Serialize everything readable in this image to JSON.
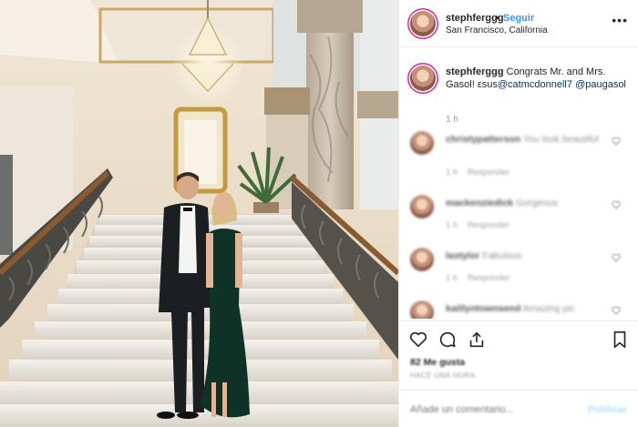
{
  "header": {
    "username": "stephferggg",
    "dot": "•",
    "follow_label": "Seguir",
    "location": "San Francisco, California",
    "more_label": "•••"
  },
  "caption": {
    "username": "stephferggg",
    "text": "Congrats Mr. and Mrs. Gasol!",
    "via": "εsus",
    "mention1": "@catmcdonnell7",
    "mention2": "@paugasol",
    "time": "1 h"
  },
  "comments": [
    {
      "username": "christypatterson",
      "text": "You look beautiful",
      "time": "1 h",
      "reply": "Responder"
    },
    {
      "username": "mackenziedick",
      "text": "Gorgeous",
      "time": "1 h",
      "reply": "Responder"
    },
    {
      "username": "lastylor",
      "text": "Fabulous",
      "time": "1 h",
      "reply": "Responder"
    },
    {
      "username": "kaitlyntownsend",
      "text": "Amazing pic",
      "time": "",
      "reply": ""
    }
  ],
  "likes": "82 Me gusta",
  "posted_ago": "HACE UNA HORA",
  "comment_input": {
    "placeholder": "Añade un comentario..."
  },
  "publish_label": "Publicar",
  "colors": {
    "link_blue": "#3897f0",
    "mention_blue": "#003569",
    "border": "#efefef",
    "muted": "#999999"
  },
  "icons": [
    "heart-icon",
    "comment-icon",
    "share-icon",
    "bookmark-icon",
    "more-icon"
  ]
}
